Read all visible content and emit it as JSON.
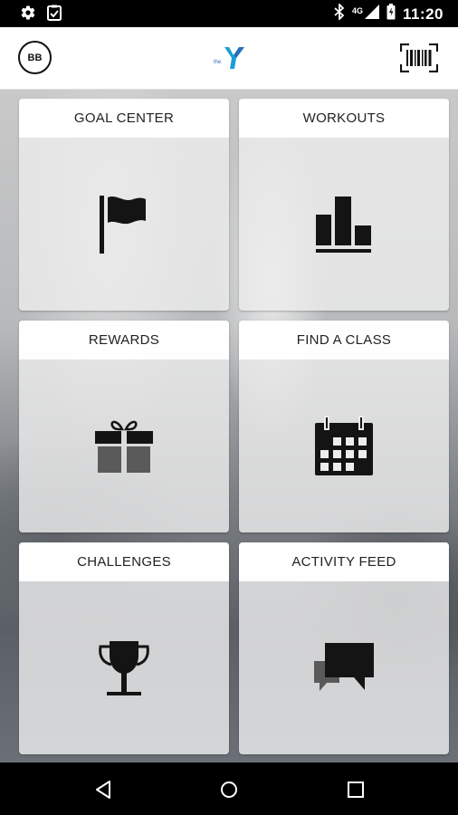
{
  "status_bar": {
    "time": "11:20",
    "network": "4G",
    "left_icons": [
      "gear-icon",
      "clipboard-check-icon"
    ],
    "right_icons": [
      "bluetooth-icon",
      "signal-icon",
      "battery-icon"
    ]
  },
  "app_bar": {
    "avatar_initials": "BB",
    "logo_text": "the",
    "logo_icon": "ymca-y-logo",
    "action_icon": "barcode-scanner-icon"
  },
  "tiles": [
    {
      "label": "GOAL CENTER",
      "icon": "flag-icon"
    },
    {
      "label": "WORKOUTS",
      "icon": "bar-chart-icon"
    },
    {
      "label": "REWARDS",
      "icon": "gift-icon"
    },
    {
      "label": "FIND A CLASS",
      "icon": "calendar-icon"
    },
    {
      "label": "CHALLENGES",
      "icon": "trophy-icon"
    },
    {
      "label": "ACTIVITY FEED",
      "icon": "chat-bubbles-icon"
    }
  ],
  "nav_bar": {
    "icons": [
      "back-icon",
      "home-icon",
      "recents-icon"
    ]
  },
  "colors": {
    "logo_accent": "#1a9fd5",
    "logo_accent_2": "#2a6fb5",
    "icon_color": "#141414"
  }
}
